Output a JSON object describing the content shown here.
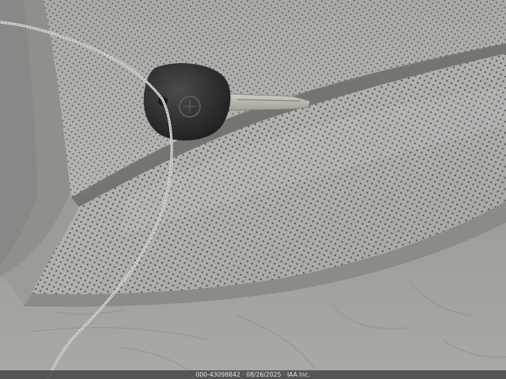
{
  "photo": {
    "subject": "perforated-leather-seat-with-key",
    "colors": {
      "leather_light": "#b6b8b4",
      "leather_mid": "#a2a4a0",
      "leather_dark": "#7e807c",
      "seam_shadow": "#5e605c",
      "perforation": "#3a3a3a",
      "key_fob": "#2e2f30",
      "key_blade": "#b9b7b0",
      "cable": "#d2d2d2"
    }
  },
  "watermark": {
    "text": "000-43098842 · 08/26/2025 · IAA Inc."
  }
}
